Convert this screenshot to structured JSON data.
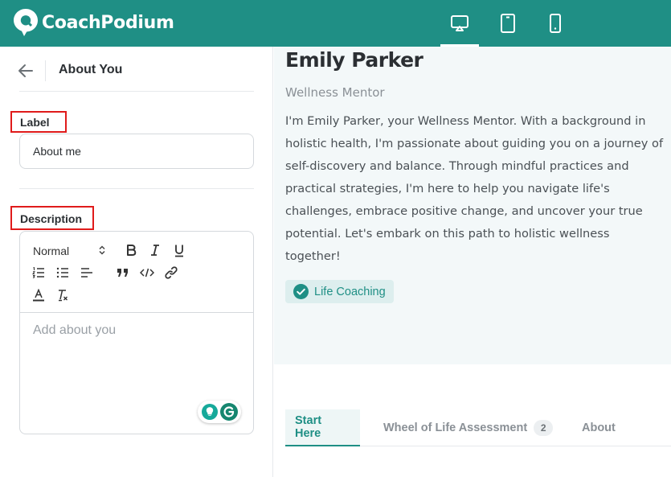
{
  "app": {
    "brand": "CoachPodium",
    "accent_color": "#1f8f85",
    "device_toggles": [
      {
        "icon": "desktop-icon",
        "active": true
      },
      {
        "icon": "tablet-icon",
        "active": false
      },
      {
        "icon": "mobile-icon",
        "active": false
      }
    ]
  },
  "panel": {
    "title": "About You",
    "label_field": {
      "label": "Label",
      "value": "About me"
    },
    "description_field": {
      "label": "Description",
      "format_select": "Normal",
      "placeholder": "Add about you",
      "toolbar_icons": [
        "bold-icon",
        "italic-icon",
        "underline-icon",
        "ordered-list-icon",
        "bullet-list-icon",
        "align-icon",
        "quote-icon",
        "code-icon",
        "link-icon",
        "text-color-icon",
        "clear-format-icon"
      ]
    }
  },
  "preview": {
    "name": "Emily Parker",
    "role": "Wellness Mentor",
    "bio": "I'm Emily Parker, your Wellness Mentor. With a background in holistic health, I'm passionate about guiding you on a journey of self-discovery and balance. Through mindful practices and practical strategies, I'm here to help you navigate life's challenges, embrace positive change, and uncover your true potential. Let's embark on this path to holistic wellness together!",
    "tag": "Life Coaching",
    "tabs": [
      {
        "label": "Start Here",
        "active": true
      },
      {
        "label": "Wheel of Life Assessment",
        "badge": "2",
        "active": false
      },
      {
        "label": "About",
        "active": false
      }
    ]
  }
}
